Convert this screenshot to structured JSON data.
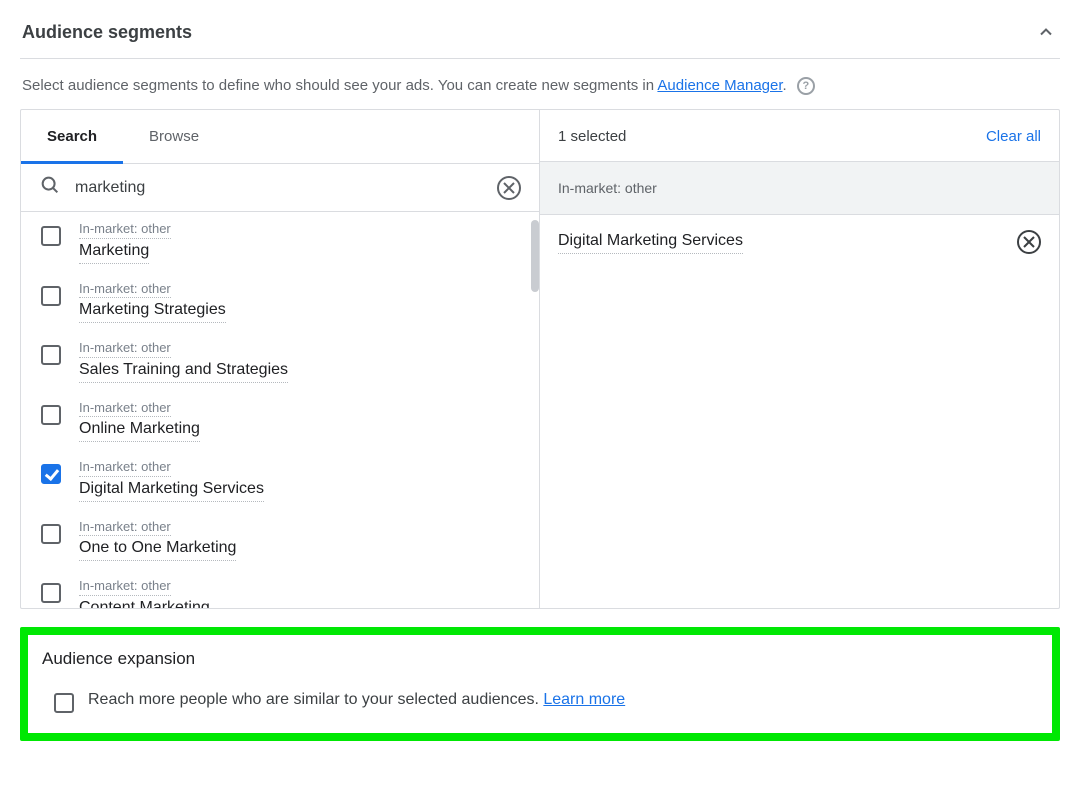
{
  "section_title": "Audience segments",
  "intro_text_a": "Select audience segments to define who should see your ads. You can create new segments in ",
  "intro_link": "Audience Manager",
  "intro_text_b": ".",
  "tabs": {
    "search": "Search",
    "browse": "Browse"
  },
  "search": {
    "value": "marketing"
  },
  "results": [
    {
      "category": "In-market: other",
      "name": "Marketing",
      "checked": false
    },
    {
      "category": "In-market: other",
      "name": "Marketing Strategies",
      "checked": false
    },
    {
      "category": "In-market: other",
      "name": "Sales Training and Strategies",
      "checked": false
    },
    {
      "category": "In-market: other",
      "name": "Online Marketing",
      "checked": false
    },
    {
      "category": "In-market: other",
      "name": "Digital Marketing Services",
      "checked": true
    },
    {
      "category": "In-market: other",
      "name": "One to One Marketing",
      "checked": false
    },
    {
      "category": "In-market: other",
      "name": "Content Marketing",
      "checked": false
    }
  ],
  "selected_header": "1 selected",
  "clear_all": "Clear all",
  "selected_group_label": "In-market: other",
  "selected_items": [
    {
      "name": "Digital Marketing Services"
    }
  ],
  "expansion": {
    "title": "Audience expansion",
    "text": "Reach more people who are similar to your selected audiences. ",
    "learn_more": "Learn more"
  }
}
